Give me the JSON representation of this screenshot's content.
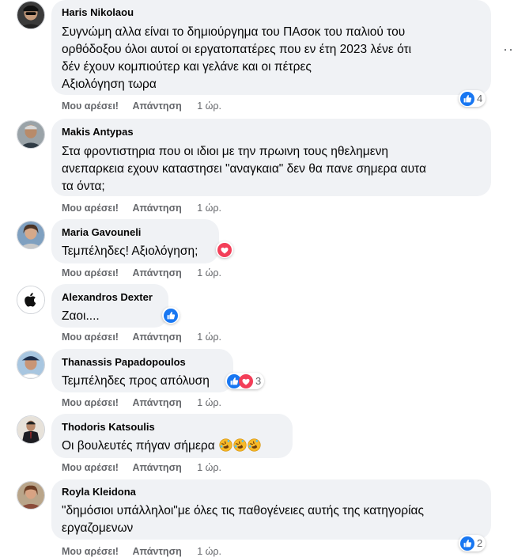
{
  "comments": [
    {
      "author": "Haris Nikolaou",
      "lines": [
        "Συγνώμη αλλα είναι το δημιούργημα του ΠΑσοκ του παλιού του",
        "ορθόδοξου όλοι αυτοί οι εργατοπατέρες που εν έτη 2023 λένε ότι",
        "δέν έχουν κομπιούτερ και γελάνε και οι πέτρες",
        "Αξιολόγηση τωρα"
      ],
      "like_label": "Μου αρέσει!",
      "reply_label": "Απάντηση",
      "time": "1 ώρ.",
      "reaction_count": "4",
      "reaction_icons": [
        "like-icon"
      ],
      "more_label": "···"
    },
    {
      "author": "Makis Antypas",
      "lines": [
        "Στα φροντιστηρια που οι ιδιοι με την πρωινη τους ηθελημενη",
        "ανεπαρκεια εχουν καταστησει \"αναγκαια\" δεν θα πανε σημερα αυτα",
        "τα όντα;"
      ],
      "like_label": "Μου αρέσει!",
      "reply_label": "Απάντηση",
      "time": "1 ώρ."
    },
    {
      "author": "Maria Gavouneli",
      "lines": [
        "Τεμπέληδες! Αξιολόγηση;"
      ],
      "like_label": "Μου αρέσει!",
      "reply_label": "Απάντηση",
      "time": "1 ώρ.",
      "reaction_icons": [
        "love-icon"
      ]
    },
    {
      "author": "Alexandros Dexter",
      "lines": [
        "Ζαοι...."
      ],
      "like_label": "Μου αρέσει!",
      "reply_label": "Απάντηση",
      "time": "1 ώρ.",
      "reaction_icons": [
        "like-icon"
      ]
    },
    {
      "author": "Thanassis Papadopoulos",
      "lines": [
        "Τεμπέληδες προς απόλυση"
      ],
      "like_label": "Μου αρέσει!",
      "reply_label": "Απάντηση",
      "time": "1 ώρ.",
      "reaction_count": "3",
      "reaction_icons": [
        "like-icon",
        "love-icon"
      ]
    },
    {
      "author": "Thodoris Katsoulis",
      "lines": [
        "Οι βουλευτές πήγαν σήμερα"
      ],
      "emojis": [
        "rofl-emoji",
        "rofl-emoji",
        "rofl-emoji"
      ],
      "like_label": "Μου αρέσει!",
      "reply_label": "Απάντηση",
      "time": "1 ώρ."
    },
    {
      "author": "Royla Kleidona",
      "lines": [
        "\"δημόσιοι υπάλληλοι\"με όλες τις παθογένειες αυτής της κατηγορίας",
        "εργαζομενων"
      ],
      "like_label": "Μου αρέσει!",
      "reply_label": "Απάντηση",
      "time": "1 ώρ.",
      "reaction_count": "2",
      "reaction_icons": [
        "like-icon"
      ]
    }
  ],
  "colors": {
    "bubble": "#f0f2f5",
    "meta_text": "#65676b",
    "like_blue": "#1877f2",
    "love_red": "#f33e58"
  }
}
